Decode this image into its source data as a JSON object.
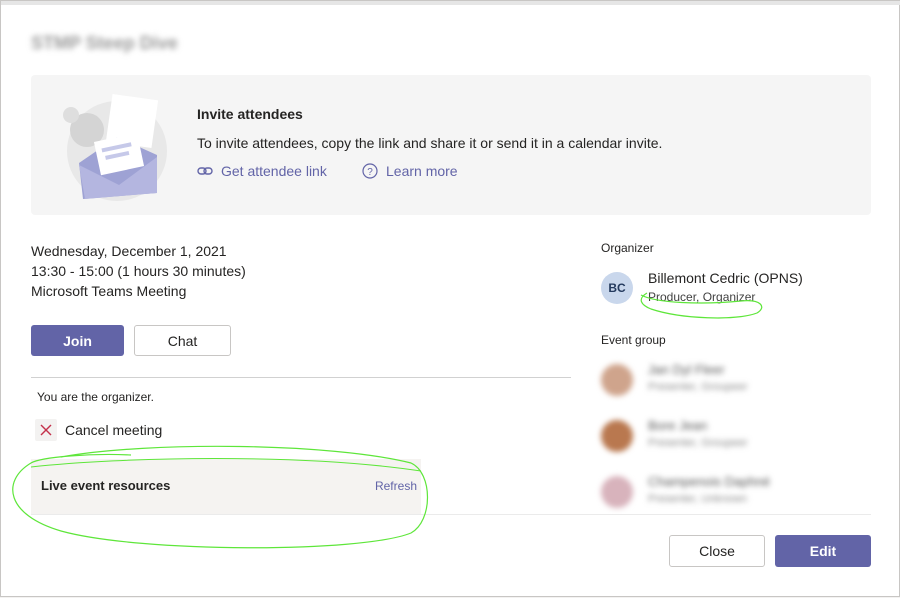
{
  "dialog": {
    "title": "STMP Steep Dive"
  },
  "invite": {
    "title": "Invite attendees",
    "description": "To invite attendees, copy the link and share it or send it in a calendar invite.",
    "get_link_label": "Get attendee link",
    "get_link_icon": "link-icon",
    "learn_more_label": "Learn more",
    "learn_more_icon": "question-circle-icon"
  },
  "meeting": {
    "date": "Wednesday, December 1, 2021",
    "time": "13:30 - 15:00 (1 hours 30 minutes)",
    "type": "Microsoft Teams Meeting"
  },
  "actions": {
    "join_label": "Join",
    "chat_label": "Chat"
  },
  "organizer_note": "You are the organizer.",
  "cancel": {
    "label": "Cancel meeting",
    "icon": "close-icon"
  },
  "resources": {
    "title": "Live event resources",
    "refresh_label": "Refresh"
  },
  "organizer": {
    "section_label": "Organizer",
    "initials": "BC",
    "name": "Billemont Cedric (OPNS)",
    "role": "Producer, Organizer"
  },
  "event_group": {
    "section_label": "Event group",
    "members": [
      {
        "name": "Jan Dyl Fleer",
        "role": "Presenter, Groupeer",
        "photo_color": "#cfa48c"
      },
      {
        "name": "Bore Jean",
        "role": "Presenter, Groupeer",
        "photo_color": "#b9784f"
      },
      {
        "name": "Champenois Daphné",
        "role": "Presenter, Unknown",
        "photo_color": "#d8b3bc"
      }
    ]
  },
  "footer": {
    "close_label": "Close",
    "edit_label": "Edit"
  },
  "colors": {
    "accent": "#6264a7",
    "annotation": "#5ee63a"
  }
}
